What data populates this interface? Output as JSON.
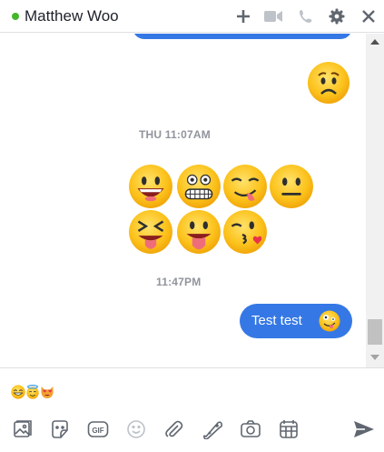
{
  "header": {
    "contact_name": "Matthew Woo",
    "presence": "online",
    "icons": [
      "plus-icon",
      "video-icon",
      "phone-icon",
      "gear-icon",
      "close-icon"
    ]
  },
  "conversation": {
    "timestamps": [
      "THU 11:07AM",
      "11:47PM"
    ],
    "sent_message": "Test test"
  },
  "composer": {
    "draft_emojis": [
      "grinning",
      "halo",
      "heart-eyes-cat"
    ]
  },
  "toolbar": {
    "icons": [
      "photo-icon",
      "sticker-icon",
      "gif-icon",
      "emoji-icon",
      "attachment-icon",
      "game-icon",
      "camera-icon",
      "plan-icon",
      "send-icon"
    ]
  },
  "colors": {
    "accent": "#3578e5",
    "presence": "#42b72a",
    "icon_gray": "#606770",
    "emoji_yellow": "#fcc21b"
  }
}
